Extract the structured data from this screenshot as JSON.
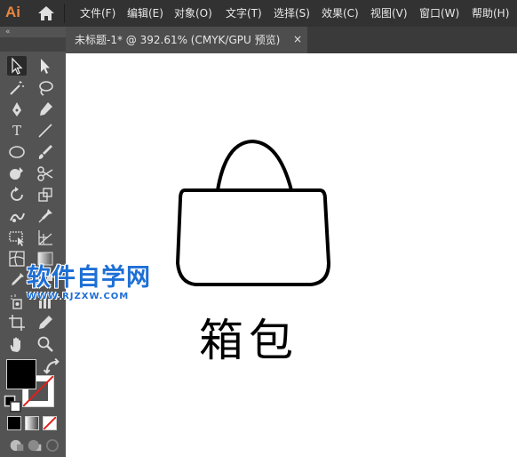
{
  "app": {
    "logo_text": "Ai"
  },
  "menu": [
    "文件(F)",
    "编辑(E)",
    "对象(O)",
    "文字(T)",
    "选择(S)",
    "效果(C)",
    "视图(V)",
    "窗口(W)",
    "帮助(H)"
  ],
  "tab": {
    "title": "未标题-1* @ 392.61% (CMYK/GPU 预览)",
    "close_glyph": "×"
  },
  "toolbar": {
    "collapse_glyph": "«",
    "type_tool_glyph": "T",
    "fill_color": "#000000",
    "stroke_color": "#ffffff"
  },
  "canvas": {
    "caption": "箱包"
  },
  "watermark": {
    "main": "软件自学网",
    "sub": "WWW.RJZXW.COM"
  }
}
